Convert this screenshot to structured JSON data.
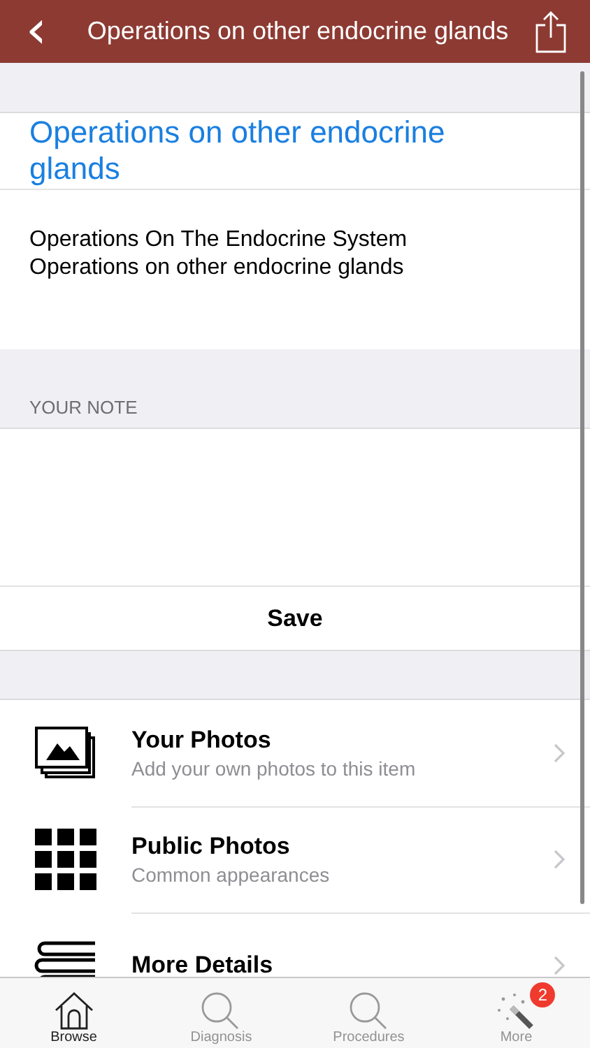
{
  "nav_bar": {
    "back_icon": "‹",
    "title": "Operations on other endocrine glands"
  },
  "heading": "Operations on other endocrine glands",
  "breadcrumb_lines": [
    "Operations On The Endocrine System",
    "Operations on other endocrine glands"
  ],
  "note": {
    "section_label": "YOUR NOTE",
    "save_label": "Save"
  },
  "menu_items": [
    {
      "kind": "photos",
      "title": "Your Photos",
      "subtitle": "Add your own photos to this item"
    },
    {
      "kind": "grid",
      "title": "Public Photos",
      "subtitle": "Common appearances"
    },
    {
      "kind": "books",
      "title": "More Details"
    }
  ],
  "tab_bar": [
    {
      "kind": "home",
      "label": "Browse",
      "selected": true
    },
    {
      "kind": "search",
      "label": "Diagnosis",
      "selected": false
    },
    {
      "kind": "search",
      "label": "Procedures",
      "selected": false
    },
    {
      "kind": "wand",
      "label": "More",
      "selected": false,
      "badge": "2"
    }
  ]
}
